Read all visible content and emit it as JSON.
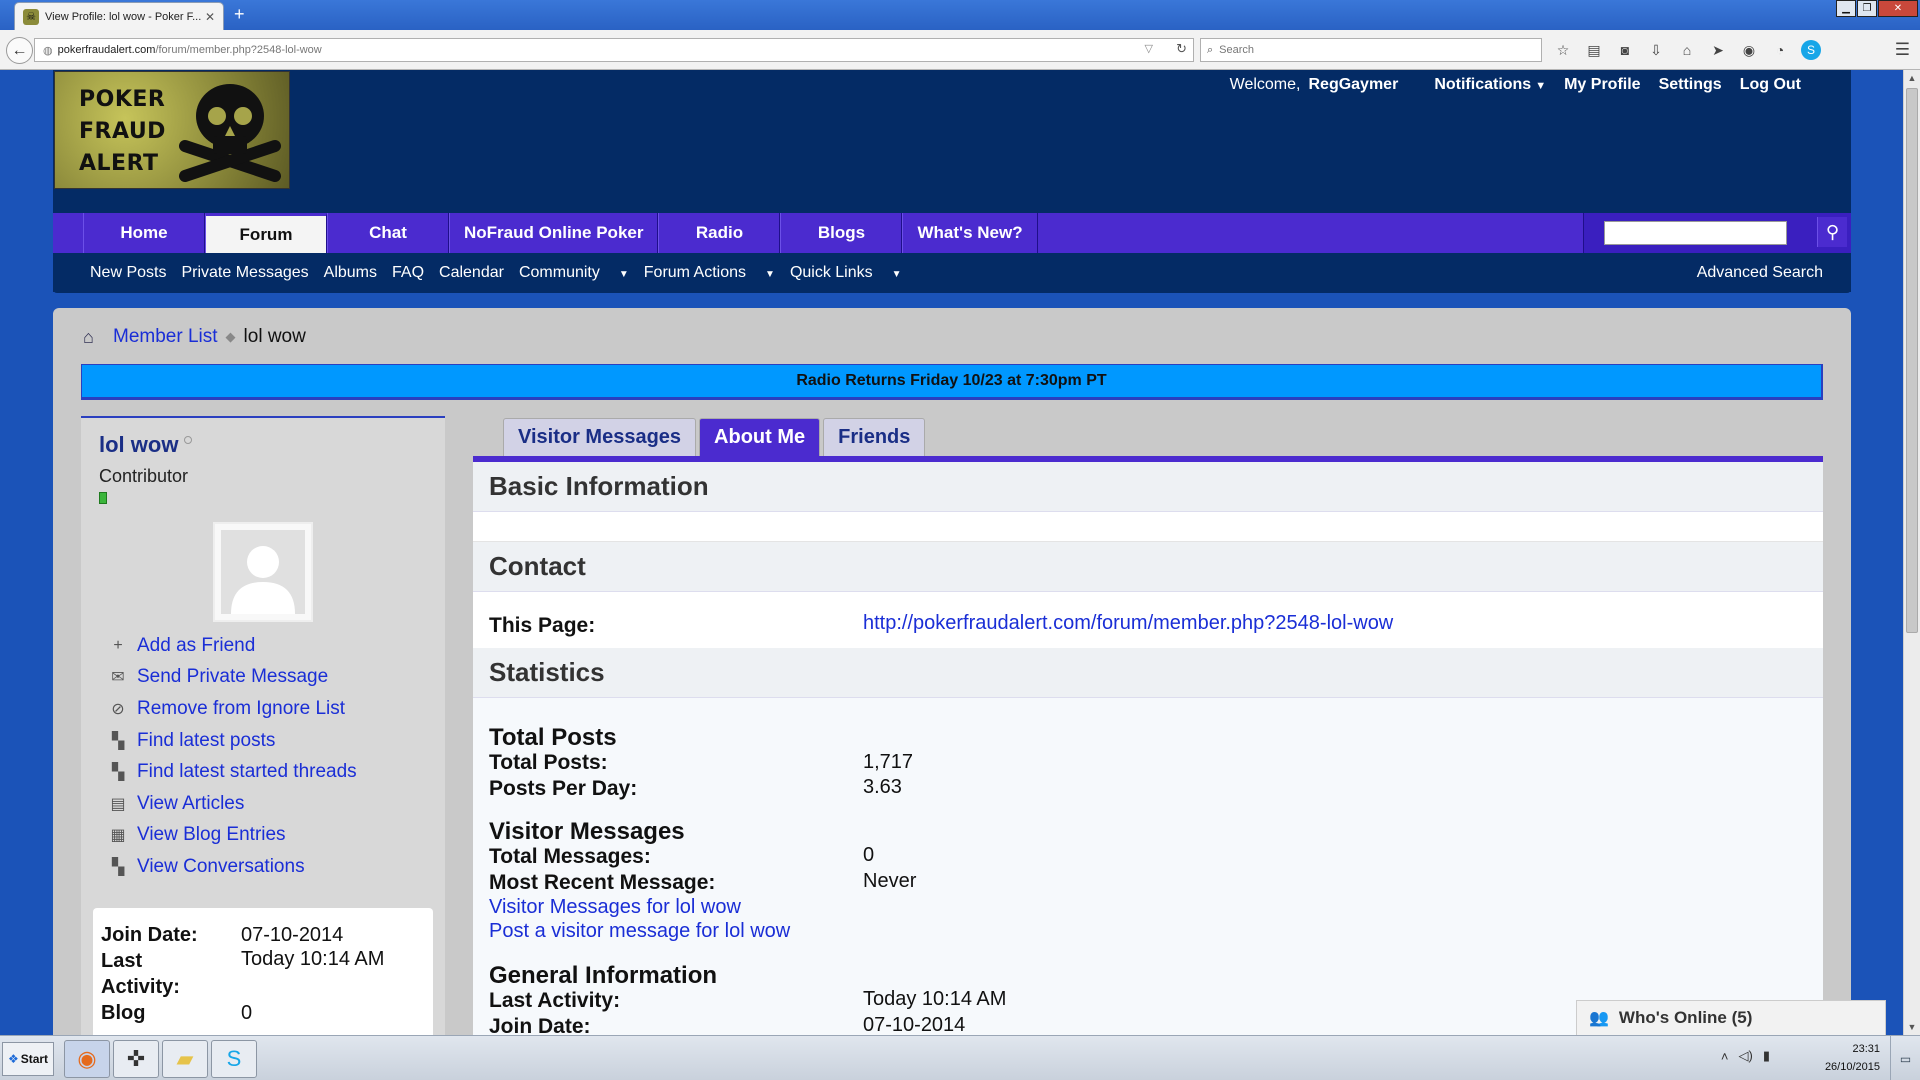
{
  "browser": {
    "tab_title": "View Profile: lol wow - Poker F...",
    "tab_close": "✕",
    "new_tab": "+",
    "url_host": "pokerfraudalert.com",
    "url_path": "/forum/member.php?2548-lol-wow",
    "search_placeholder": "Search",
    "window_controls": {
      "minimize": "▁",
      "maximize": "❐",
      "close": "✕"
    },
    "toolbar_icons": [
      "star-icon",
      "reading-list-icon",
      "pocket-icon",
      "download-icon",
      "home-icon",
      "send-icon",
      "adblock-icon",
      "chat-icon",
      "skype-icon"
    ]
  },
  "site": {
    "logo_text": "POKER FRAUD ALERT",
    "user_bar": {
      "welcome": "Welcome,",
      "username": "RegGaymer",
      "notifications": "Notifications",
      "my_profile": "My Profile",
      "settings": "Settings",
      "log_out": "Log Out"
    },
    "nav_tabs": [
      "Home",
      "Forum",
      "Chat",
      "NoFraud Online Poker",
      "Radio",
      "Blogs",
      "What's New?"
    ],
    "active_tab": "Forum",
    "sub_nav": [
      "New Posts",
      "Private Messages",
      "Albums",
      "FAQ",
      "Calendar",
      "Community",
      "Forum Actions",
      "Quick Links"
    ],
    "advanced_search": "Advanced Search"
  },
  "breadcrumb": {
    "member_list": "Member List",
    "current": "lol wow"
  },
  "notice": "Radio Returns Friday 10/23 at 7:30pm PT",
  "sidebar": {
    "username": "lol wow",
    "rank": "Contributor",
    "actions": [
      {
        "label": "Add as Friend",
        "icon": "plus-icon"
      },
      {
        "label": "Send Private Message",
        "icon": "envelope-icon"
      },
      {
        "label": "Remove from Ignore List",
        "icon": "block-icon"
      },
      {
        "label": "Find latest posts",
        "icon": "posts-icon"
      },
      {
        "label": "Find latest started threads",
        "icon": "threads-icon"
      },
      {
        "label": "View Articles",
        "icon": "articles-icon"
      },
      {
        "label": "View Blog Entries",
        "icon": "blog-icon"
      },
      {
        "label": "View Conversations",
        "icon": "conversations-icon"
      }
    ],
    "info": {
      "join_date_label": "Join Date:",
      "join_date": "07-10-2014",
      "last_activity_label": "Last Activity:",
      "last_activity": "Today 10:14 AM",
      "blog_label": "Blog",
      "blog": "0"
    }
  },
  "profile_tabs": [
    "Visitor Messages",
    "About Me",
    "Friends"
  ],
  "active_profile_tab": "About Me",
  "about": {
    "basic_information": "Basic Information",
    "contact": "Contact",
    "this_page_label": "This Page:",
    "this_page_url": "http://pokerfraudalert.com/forum/member.php?2548-lol-wow",
    "statistics": "Statistics",
    "total_posts_head": "Total Posts",
    "total_posts_label": "Total Posts:",
    "total_posts": "1,717",
    "posts_per_day_label": "Posts Per Day:",
    "posts_per_day": "3.63",
    "visitor_messages_head": "Visitor Messages",
    "total_messages_label": "Total Messages:",
    "total_messages": "0",
    "most_recent_label": "Most Recent Message:",
    "most_recent": "Never",
    "vm_link": "Visitor Messages for lol wow",
    "post_vm_link": "Post a visitor message for lol wow",
    "general_head": "General Information",
    "gen_last_activity_label": "Last Activity:",
    "gen_last_activity": "Today 10:14 AM",
    "gen_join_date_label": "Join Date:",
    "gen_join_date": "07-10-2014"
  },
  "whos_online": "Who's Online (5)",
  "taskbar": {
    "start": "Start",
    "time": "23:31",
    "date": "26/10/2015"
  }
}
